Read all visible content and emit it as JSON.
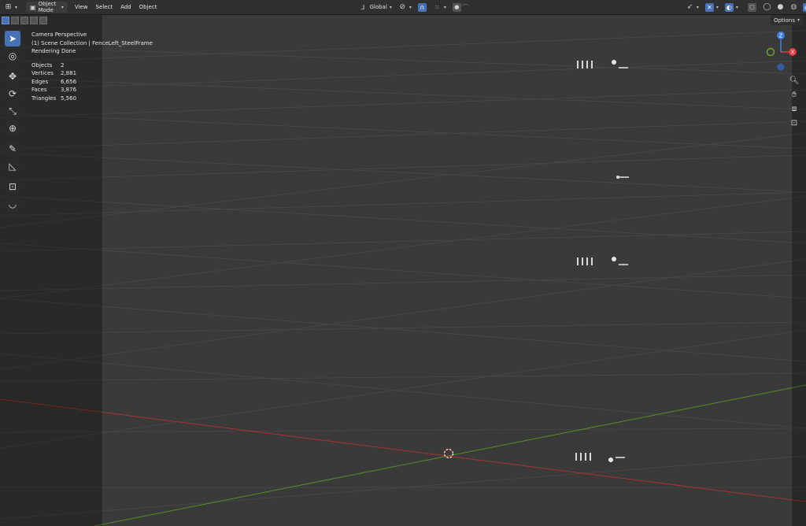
{
  "header": {
    "editor_type_icon": "3d-viewport-icon",
    "mode_label": "Object Mode",
    "menus": [
      "View",
      "Select",
      "Add",
      "Object"
    ],
    "transform_orientation": "Global",
    "options_label": "Options"
  },
  "overlay": {
    "view_name": "Camera Perspective",
    "collection_line": "(1) Scene Collection | FenceLeft_SteelFrame",
    "status": "Rendering Done",
    "stats": [
      {
        "label": "Objects",
        "value": "2"
      },
      {
        "label": "Vertices",
        "value": "2,881"
      },
      {
        "label": "Edges",
        "value": "6,656"
      },
      {
        "label": "Faces",
        "value": "3,876"
      },
      {
        "label": "Triangles",
        "value": "5,560"
      }
    ]
  },
  "toolbar": {
    "tools": [
      "select-box",
      "cursor",
      "move",
      "rotate",
      "scale",
      "transform",
      "annotate",
      "measure",
      "add-cube",
      "curve"
    ]
  },
  "gizmo": {
    "x_label": "X",
    "z_label": "Z",
    "colors": {
      "x": "#e8393f",
      "y": "#6fa22b",
      "z": "#3b7fe0"
    }
  },
  "colors": {
    "accent": "#4772b3",
    "x_axis": "#c0373d",
    "y_axis": "#6c9a2c",
    "viewport_bg": "#3a3a3a",
    "header_bg": "#303030"
  }
}
